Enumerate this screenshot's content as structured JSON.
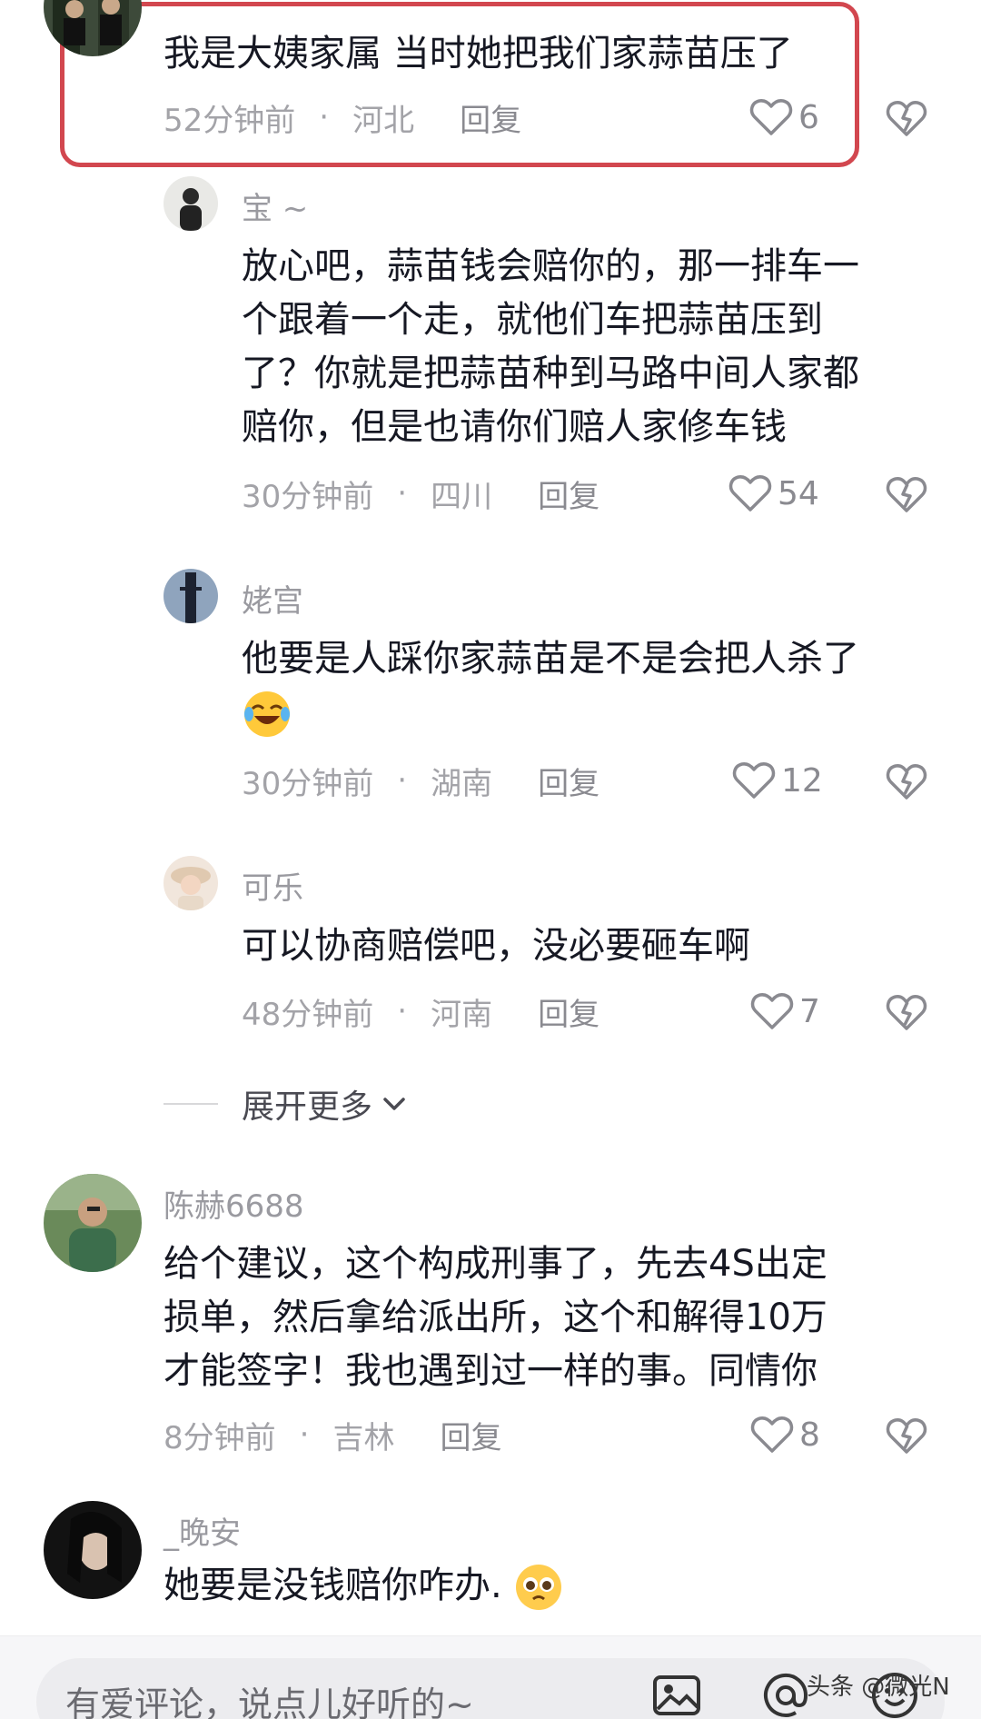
{
  "comments": [
    {
      "username": "",
      "lines": [
        "我是大姨家属 当时她把我们家蒜苗压了"
      ],
      "time": "52分钟前",
      "location": "河北",
      "reply_label": "回复",
      "likes": "6",
      "highlighted": true
    },
    {
      "username": "宝 ~",
      "lines": [
        "放心吧，蒜苗钱会赔你的，那一排车一",
        "个跟着一个走，就他们车把蒜苗压到",
        "了？你就是把蒜苗种到马路中间人家都",
        "赔你，但是也请你们赔人家修车钱"
      ],
      "time": "30分钟前",
      "location": "四川",
      "reply_label": "回复",
      "likes": "54"
    },
    {
      "username": "姥宫",
      "lines": [
        "他要是人踩你家蒜苗是不是会把人杀了"
      ],
      "emoji": "laughing-tears-emoji",
      "time": "30分钟前",
      "location": "湖南",
      "reply_label": "回复",
      "likes": "12"
    },
    {
      "username": "可乐",
      "lines": [
        "可以协商赔偿吧，没必要砸车啊"
      ],
      "time": "48分钟前",
      "location": "河南",
      "reply_label": "回复",
      "likes": "7"
    },
    {
      "username": "陈赫6688",
      "lines": [
        "给个建议，这个构成刑事了，先去4S出定",
        "损单，然后拿给派出所，这个和解得10万",
        "才能签字！我也遇到过一样的事。同情你"
      ],
      "time": "8分钟前",
      "location": "吉林",
      "reply_label": "回复",
      "likes": "8"
    },
    {
      "username": "_晚安",
      "lines": [
        "她要是没钱赔你咋办."
      ],
      "emoji": "pleading-face-emoji"
    }
  ],
  "expand_more": "展开更多",
  "input": {
    "placeholder": "有爱评论，说点儿好听的~"
  },
  "watermark": "头条 @微光N",
  "colors": {
    "highlight_border": "#d2474f",
    "text_primary": "#161823",
    "text_secondary": "#a3a3a8"
  }
}
